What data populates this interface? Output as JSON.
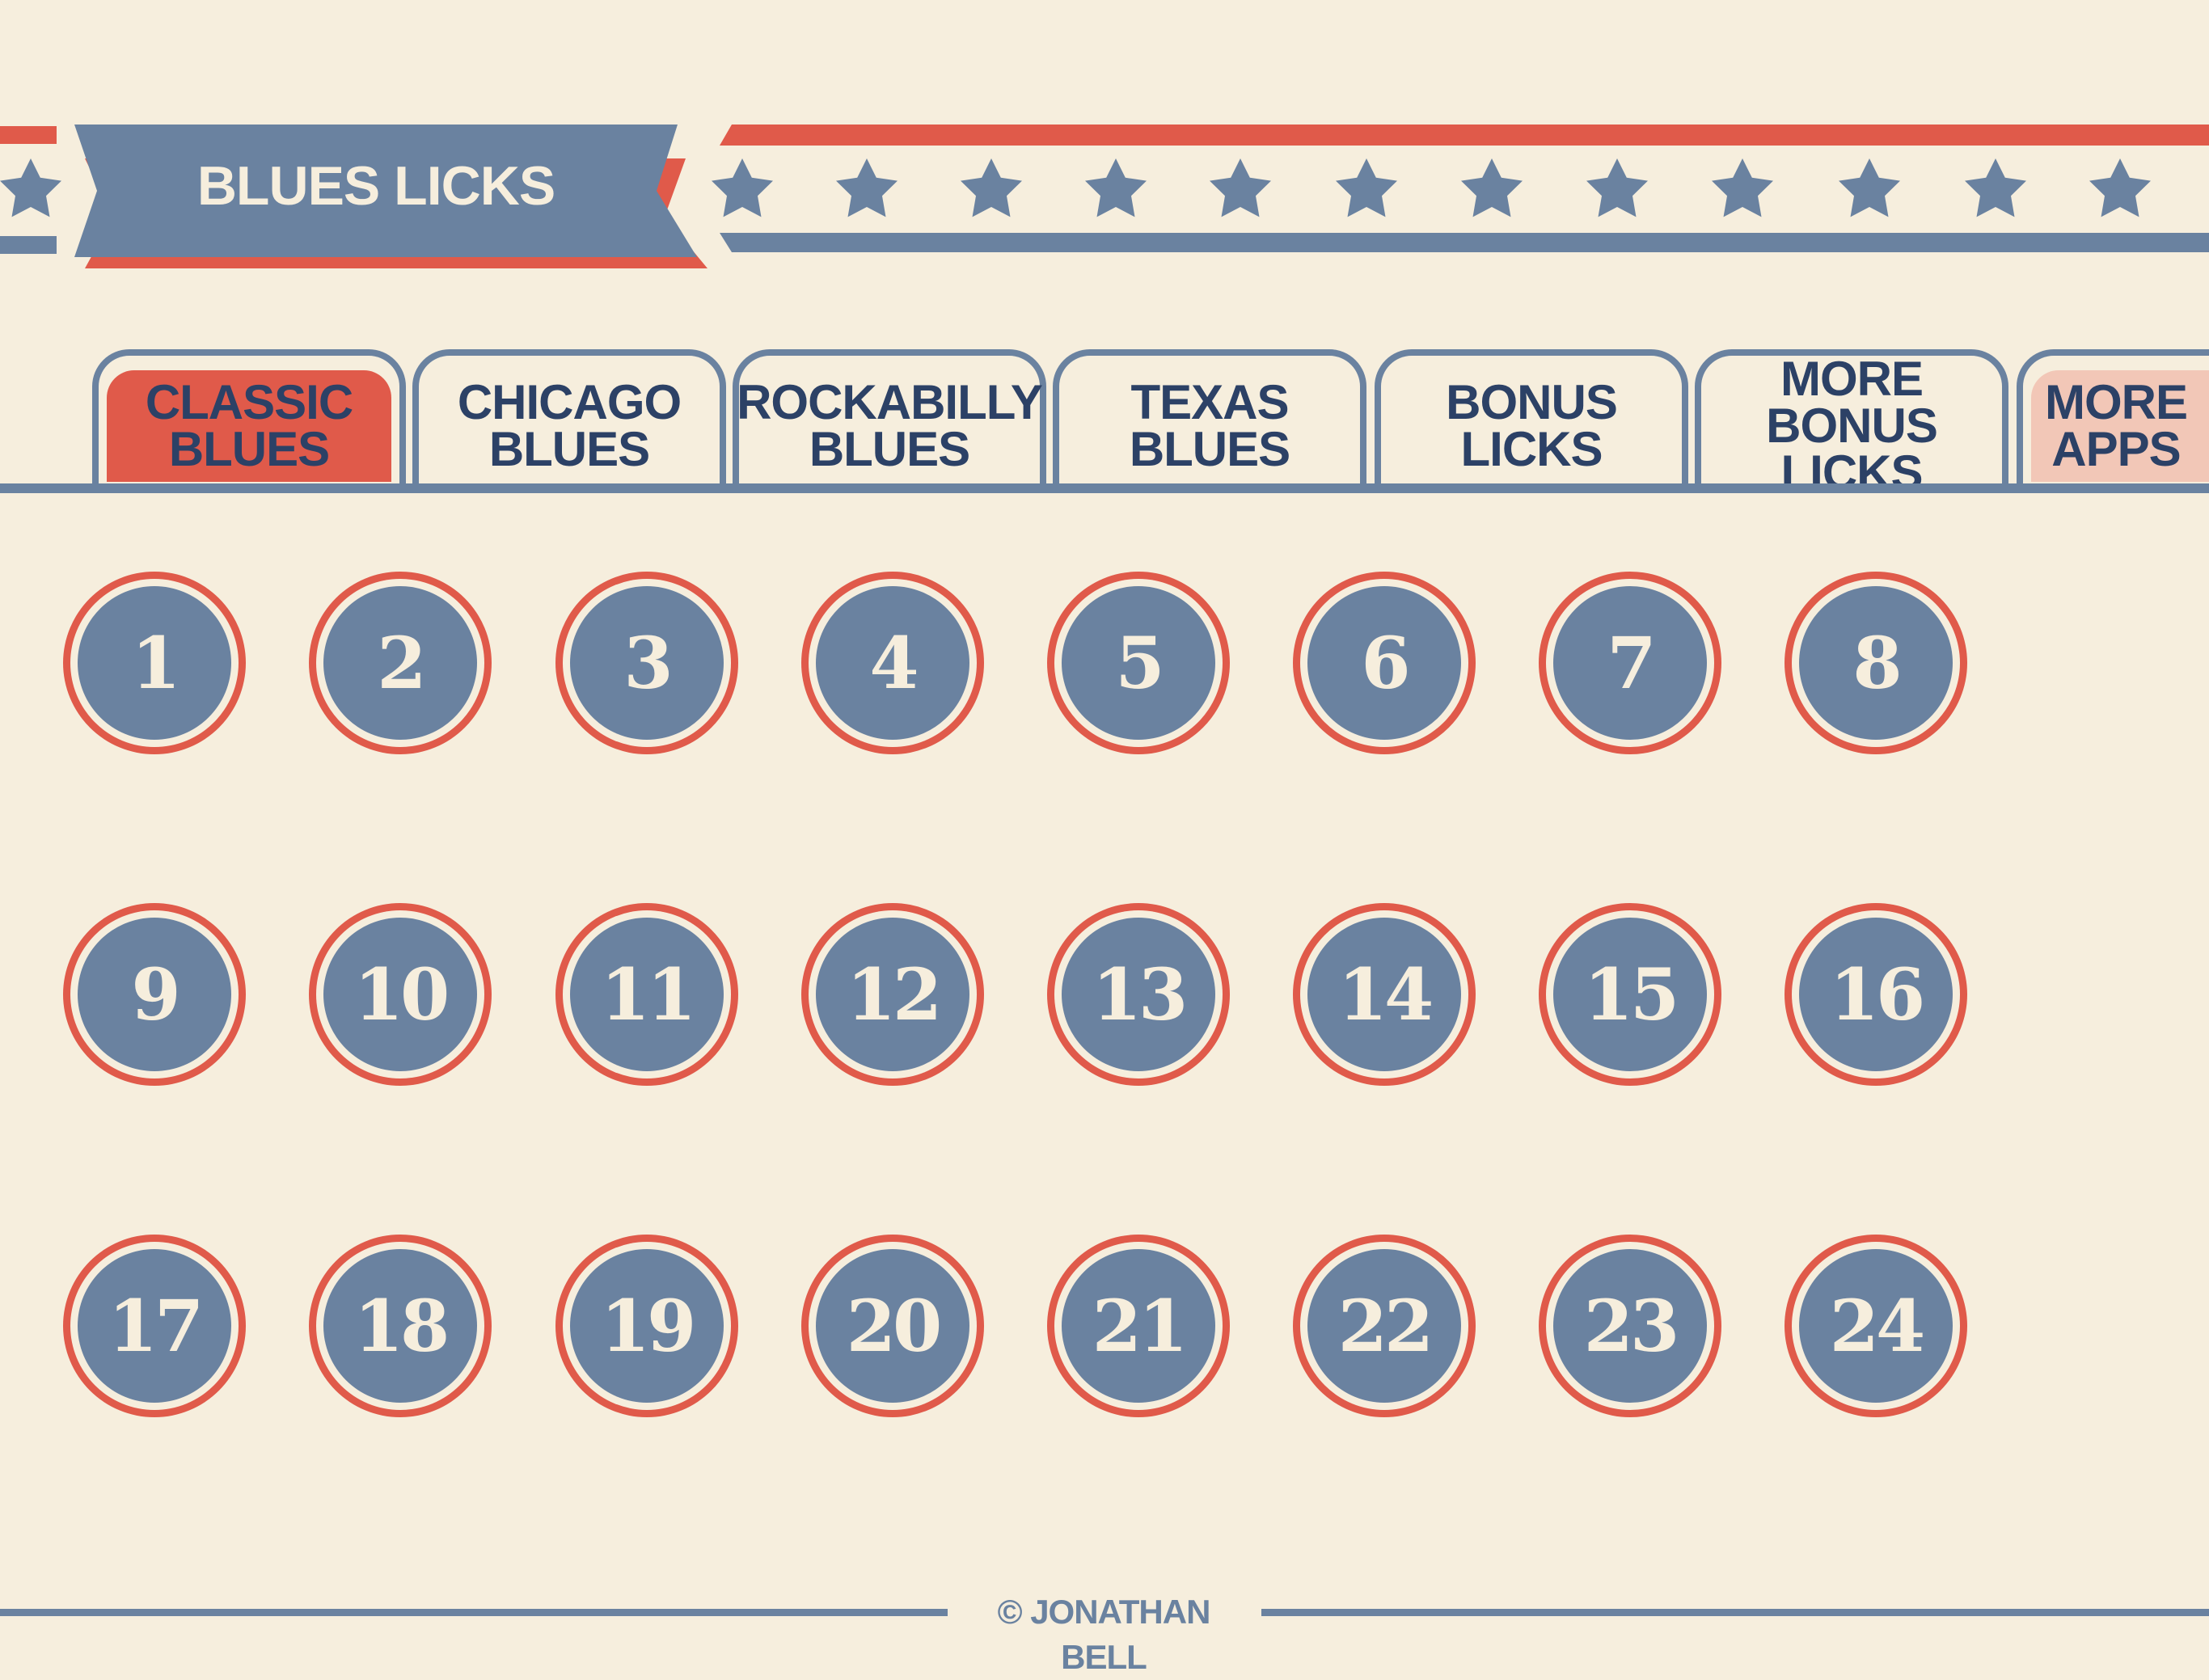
{
  "app": {
    "title": "BLUES LICKS"
  },
  "colors": {
    "background": "#f6eedd",
    "blue": "#6a82a0",
    "red": "#e05a4a",
    "dark_text": "#2c4166",
    "pink": "#f2c7b7"
  },
  "header": {
    "banner_icon": "star-icon"
  },
  "tabs": [
    {
      "label": "CLASSIC\nBLUES",
      "state": "active"
    },
    {
      "label": "CHICAGO\nBLUES",
      "state": "normal"
    },
    {
      "label": "ROCKABILLY\nBLUES",
      "state": "normal"
    },
    {
      "label": "TEXAS\nBLUES",
      "state": "normal"
    },
    {
      "label": "BONUS\nLICKS",
      "state": "normal"
    },
    {
      "label": "MORE BONUS\nLICKS",
      "state": "normal"
    },
    {
      "label": "MORE\nAPPS",
      "state": "highlight"
    }
  ],
  "licks": [
    "1",
    "2",
    "3",
    "4",
    "5",
    "6",
    "7",
    "8",
    "9",
    "10",
    "11",
    "12",
    "13",
    "14",
    "15",
    "16",
    "17",
    "18",
    "19",
    "20",
    "21",
    "22",
    "23",
    "24"
  ],
  "footer": {
    "credit": "© JONATHAN BELL"
  }
}
